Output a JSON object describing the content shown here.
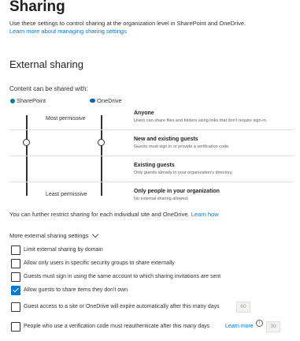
{
  "page": {
    "title": "Sharing",
    "description": "Use these settings to control sharing at the organization level in SharePoint and OneDrive.",
    "learn_more_link": "Learn more about managing sharing settings"
  },
  "external_sharing": {
    "title": "External sharing",
    "content_label": "Content can be shared with:",
    "columns": {
      "sharepoint": "SharePoint",
      "onedrive": "OneDrive"
    },
    "most_permissive": "Most permissive",
    "least_permissive": "Least permissive",
    "options": [
      {
        "title": "Anyone",
        "description": "Users can share files and folders using links that don't require sign-in."
      },
      {
        "title": "New and existing guests",
        "description": "Guests must sign in or provide a verification code."
      },
      {
        "title": "Existing guests",
        "description": "Only guests already in your organization's directory."
      },
      {
        "title": "Only people in your organization",
        "description": "No external sharing allowed."
      }
    ],
    "sharepoint_level": "New and existing guests",
    "onedrive_level": "New and existing guests",
    "restrict_text": "You can further restrict sharing for each individual site and OneDrive.",
    "learn_how_link": "Learn how"
  },
  "more_settings": {
    "label": "More external sharing settings",
    "checkboxes": [
      {
        "label": "Limit external sharing by domain",
        "checked": false
      },
      {
        "label": "Allow only users in specific security groups to share externally",
        "checked": false
      },
      {
        "label": "Guests must sign in using the same account to which sharing invitations are sent",
        "checked": false
      },
      {
        "label": "Allow guests to share items they don't own",
        "checked": true
      },
      {
        "label": "Guest access to a site or OneDrive will expire automatically after this many days",
        "checked": false,
        "value": "60"
      },
      {
        "label": "People who use a verification code must reauthenticate after this many days",
        "checked": false,
        "learn_more": "Learn more",
        "value": "30"
      }
    ]
  },
  "colors": {
    "accent": "#0078d4",
    "sharepoint": "#038387",
    "onedrive": "#0364b8"
  }
}
